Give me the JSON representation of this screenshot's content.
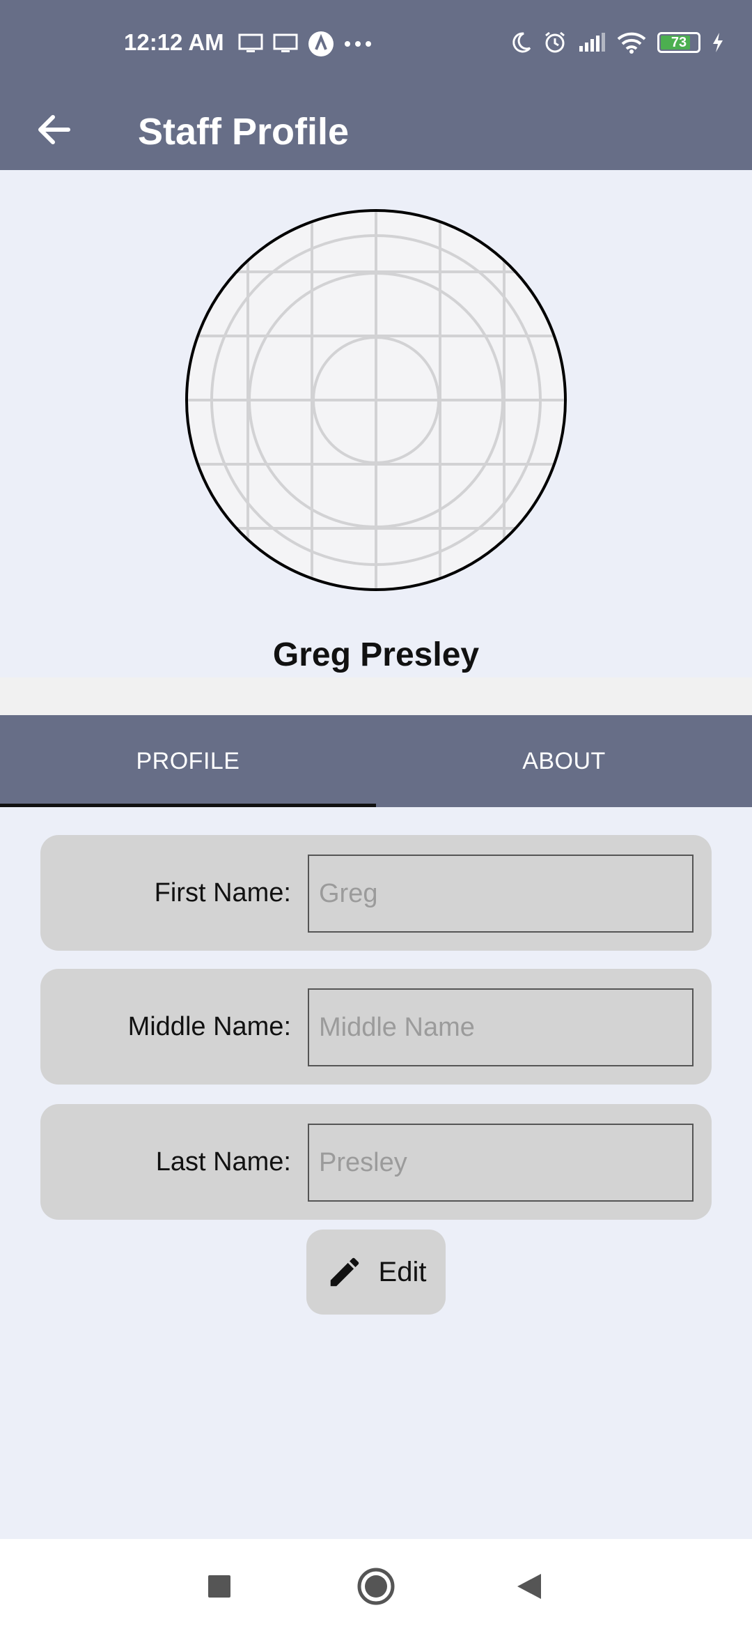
{
  "status": {
    "time": "12:12 AM",
    "battery": "73"
  },
  "appbar": {
    "title": "Staff Profile"
  },
  "profile": {
    "name": "Greg Presley"
  },
  "tabs": [
    {
      "label": "PROFILE",
      "active": true
    },
    {
      "label": "ABOUT",
      "active": false
    }
  ],
  "fields": {
    "first": {
      "label": "First Name:",
      "placeholder": "Greg",
      "value": ""
    },
    "middle": {
      "label": "Middle Name:",
      "placeholder": "Middle Name",
      "value": ""
    },
    "last": {
      "label": "Last Name:",
      "placeholder": "Presley",
      "value": ""
    }
  },
  "actions": {
    "edit_label": "Edit"
  },
  "colors": {
    "appbar": "#676e87",
    "background": "#eceff8",
    "card": "#d3d3d3"
  }
}
